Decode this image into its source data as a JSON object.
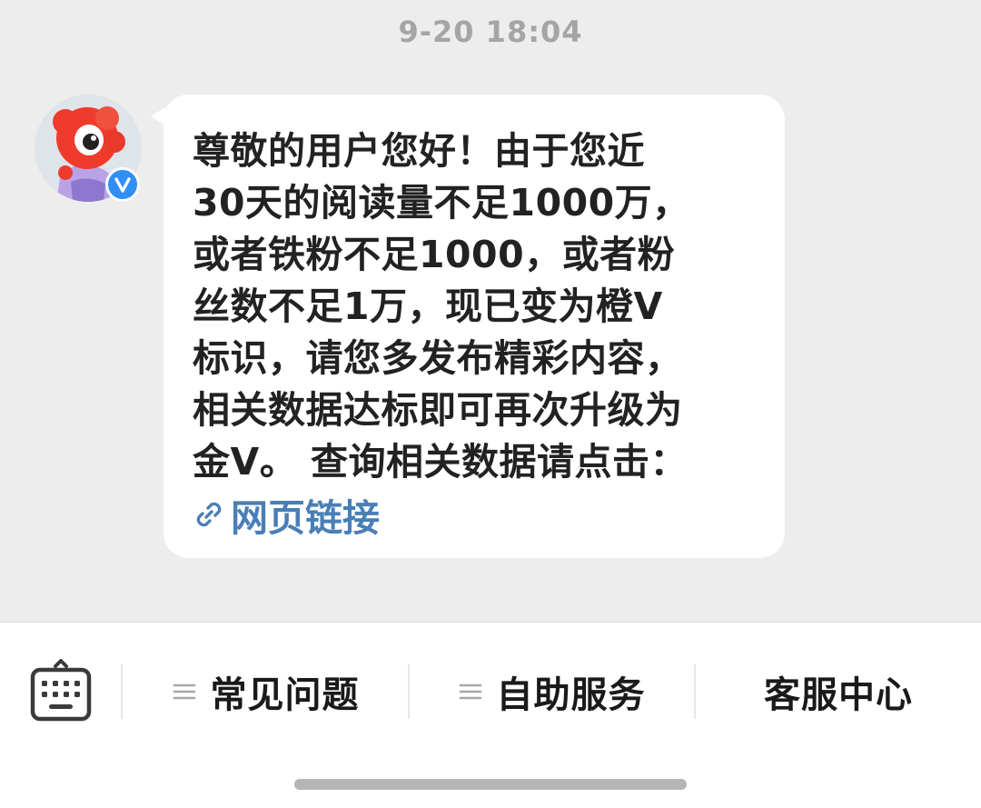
{
  "chat": {
    "timestamp": "9-20 18:04",
    "message": {
      "text": "尊敬的用户您好！由于您近\n30天的阅读量不足1000万，\n或者铁粉不足1000，或者粉\n丝数不足1万，现已变为橙V\n标识，请您多发布精彩内容，\n相关数据达标即可再次升级为\n金V。 查询相关数据请点击：",
      "link_label": "网页链接"
    },
    "avatar": {
      "icon": "weibo-mascot-avatar",
      "badge_icon": "verified-v-badge",
      "badge_letter": "V",
      "badge_color": "#2f8ff5"
    }
  },
  "bottom_bar": {
    "keyboard_icon": "keyboard-icon",
    "menu": [
      {
        "label": "常见问题",
        "icon": "menu-lines-icon"
      },
      {
        "label": "自助服务",
        "icon": "menu-lines-icon"
      },
      {
        "label": "客服中心"
      }
    ]
  },
  "colors": {
    "chat_background": "#ededed",
    "link": "#4a7fb5"
  }
}
